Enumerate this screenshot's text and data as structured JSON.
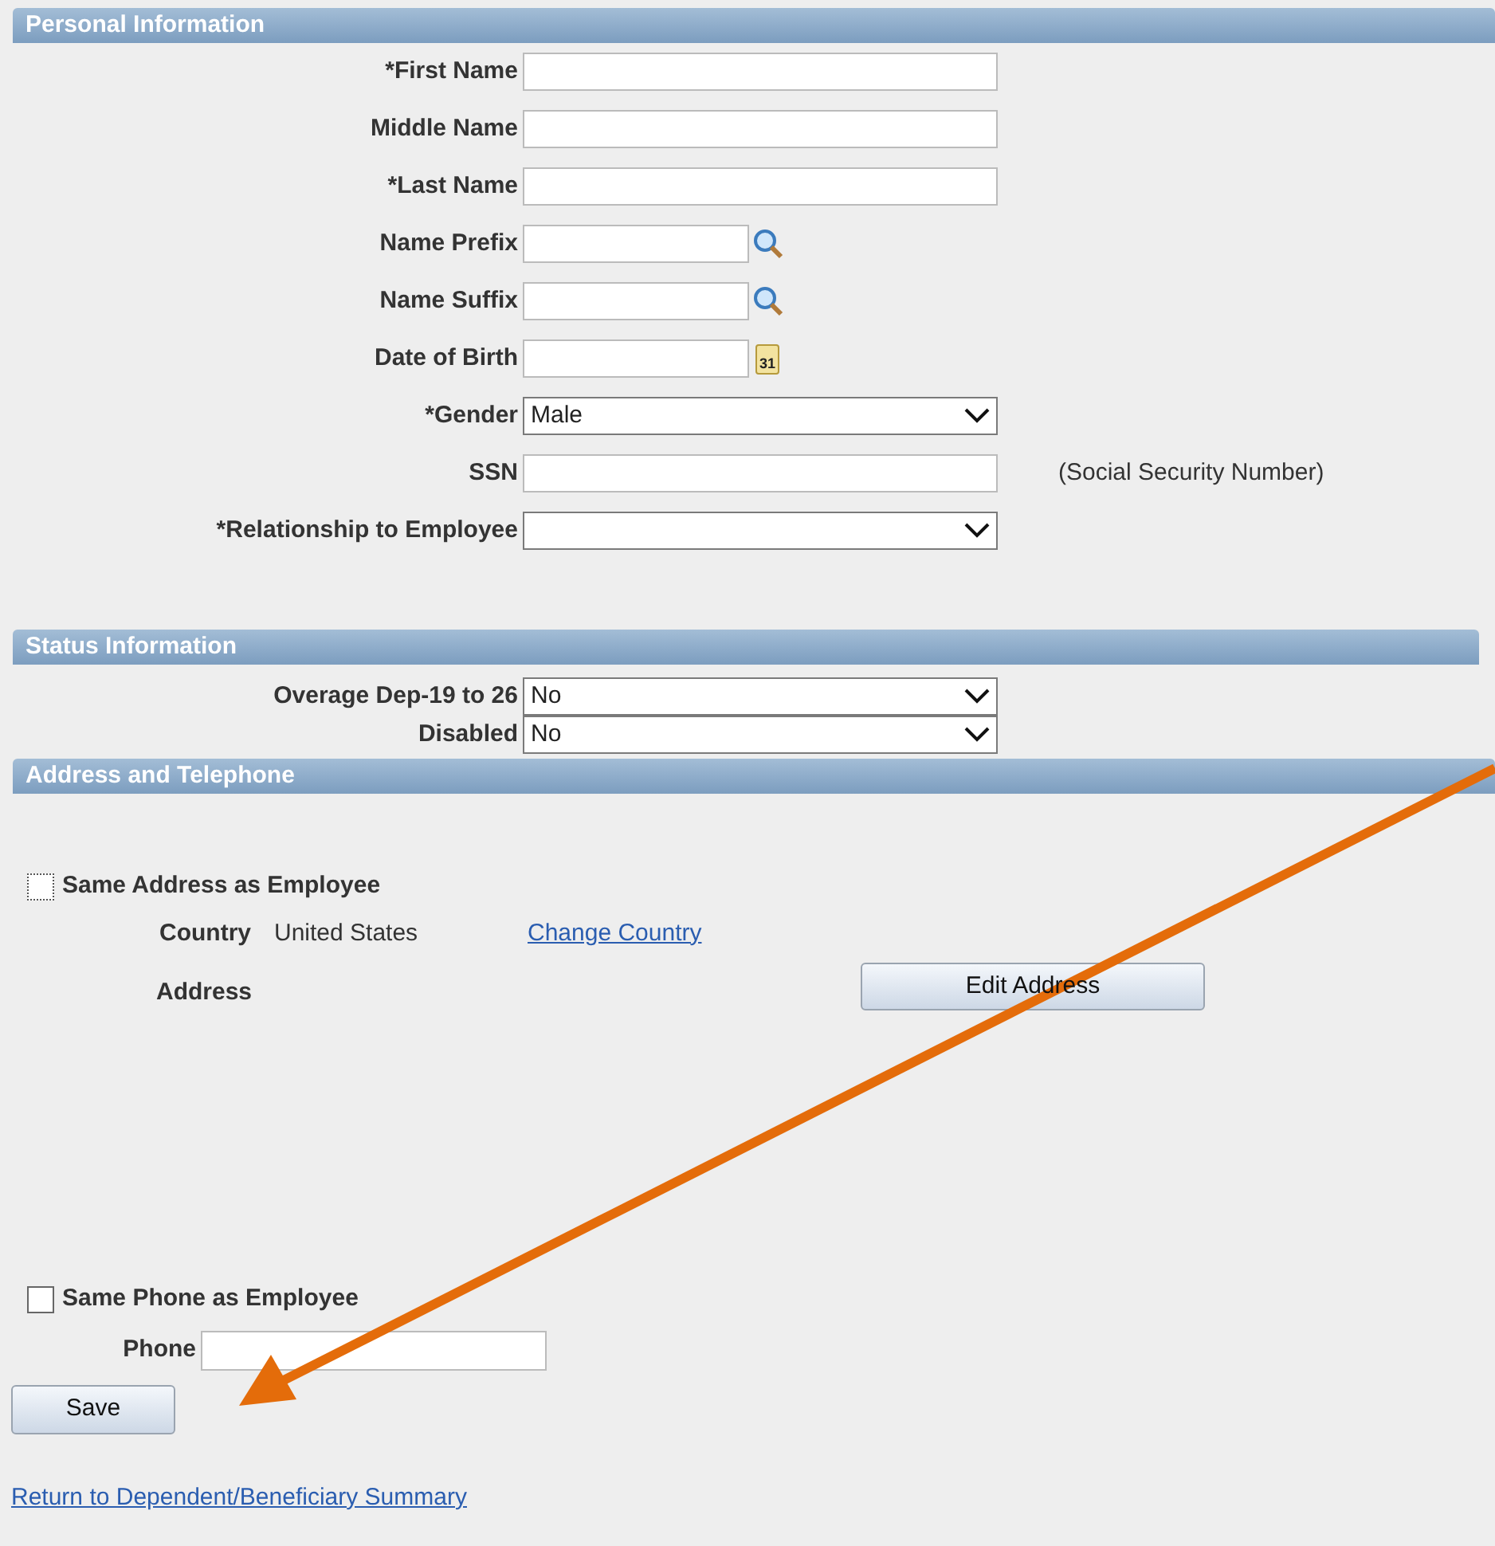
{
  "personal_information": {
    "title": "Personal Information",
    "fields": [
      {
        "label": "*First Name",
        "kind": "text"
      },
      {
        "label": "Middle Name",
        "kind": "text"
      },
      {
        "label": "*Last Name",
        "kind": "text"
      },
      {
        "label": "Name Prefix",
        "kind": "lookup"
      },
      {
        "label": "Name Suffix",
        "kind": "lookup"
      },
      {
        "label": "Date of Birth",
        "kind": "date",
        "calendar_icon_text": "31"
      },
      {
        "label": "*Gender",
        "kind": "select",
        "value": "Male"
      },
      {
        "label": "SSN",
        "kind": "text",
        "note": "(Social Security Number)"
      },
      {
        "label": "*Relationship to Employee",
        "kind": "select"
      }
    ]
  },
  "status_information": {
    "title": "Status Information",
    "fields": [
      {
        "label": "Overage Dep-19 to 26",
        "value": "No"
      },
      {
        "label": "Disabled",
        "value": "No"
      }
    ]
  },
  "address_and_telephone": {
    "title": "Address and Telephone",
    "same_address": {
      "label": "Same Address as Employee",
      "checked": false
    },
    "country_label": "Country",
    "country_value": "United States",
    "change_country_link": "Change Country",
    "address_label": "Address",
    "edit_address_button": "Edit Address",
    "same_phone": {
      "label": "Same Phone as Employee",
      "checked": false
    },
    "phone_label": "Phone"
  },
  "save_button": "Save",
  "return_link": "Return to Dependent/Beneficiary Summary"
}
